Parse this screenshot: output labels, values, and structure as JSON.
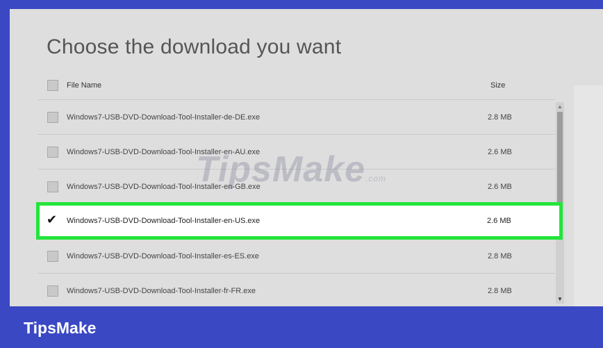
{
  "dialog": {
    "title": "Choose the download you want",
    "columns": {
      "name": "File Name",
      "size": "Size"
    },
    "files": [
      {
        "name": "Windows7-USB-DVD-Download-Tool-Installer-de-DE.exe",
        "size": "2.8 MB",
        "checked": false
      },
      {
        "name": "Windows7-USB-DVD-Download-Tool-Installer-en-AU.exe",
        "size": "2.6 MB",
        "checked": false
      },
      {
        "name": "Windows7-USB-DVD-Download-Tool-Installer-en-GB.exe",
        "size": "2.6 MB",
        "checked": false
      },
      {
        "name": "Windows7-USB-DVD-Download-Tool-Installer-en-US.exe",
        "size": "2.6 MB",
        "checked": true
      },
      {
        "name": "Windows7-USB-DVD-Download-Tool-Installer-es-ES.exe",
        "size": "2.8 MB",
        "checked": false
      },
      {
        "name": "Windows7-USB-DVD-Download-Tool-Installer-fr-FR.exe",
        "size": "2.8 MB",
        "checked": false
      }
    ]
  },
  "watermark": {
    "text": "TipsMake",
    "suffix": ".com"
  },
  "brand": {
    "label": "TipsMake"
  },
  "colors": {
    "frame": "#3a48c4",
    "highlight": "#22e53a",
    "panel": "#dedede"
  },
  "icons": {
    "check": "checkmark-icon",
    "scroll_up": "scroll-up-arrow-icon",
    "scroll_down": "scroll-down-arrow-icon"
  }
}
